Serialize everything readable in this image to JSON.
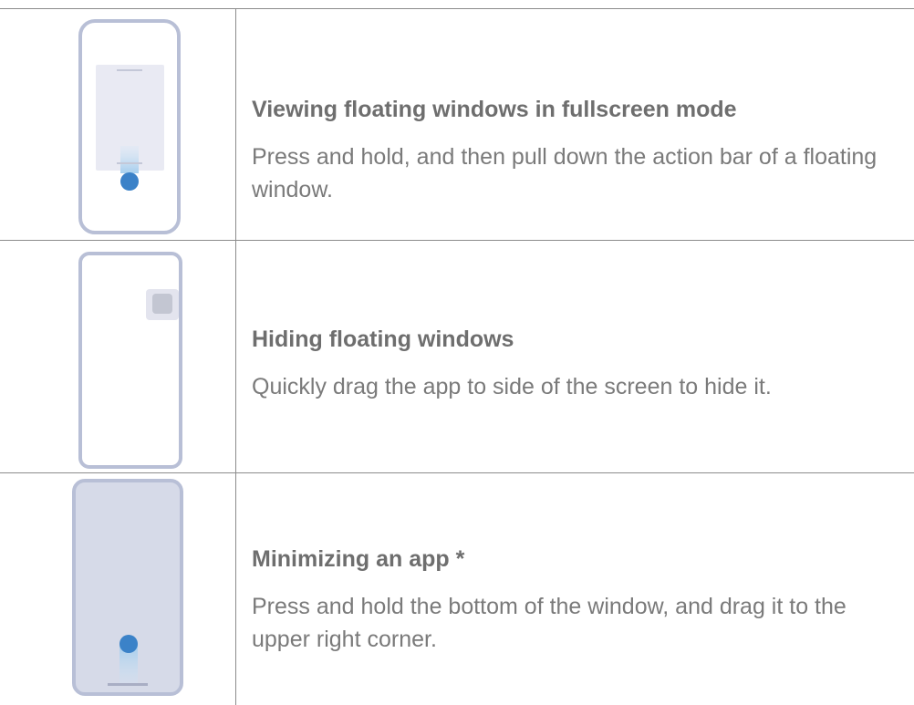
{
  "rows": [
    {
      "title": "Viewing floating windows in fullscreen mode",
      "description": "Press and hold, and then pull down the action bar of a floating  window.",
      "icon": "phone-fullscreen-gesture-icon"
    },
    {
      "title": "Hiding floating windows",
      "description": "Quickly drag the app to side of the screen to hide it.",
      "icon": "phone-hide-window-icon"
    },
    {
      "title": "Minimizing an app *",
      "description": "Press and hold the bottom of the window, and drag it to the upper right corner.",
      "icon": "phone-minimize-gesture-icon"
    }
  ],
  "colors": {
    "phone_outline": "#b8bfd6",
    "phone_fill_light": "#e9eaf3",
    "phone_fill_full": "#d6dae8",
    "touch_dot": "#3b82c8",
    "text_title": "#6e6e6e",
    "text_body": "#7a7a7a",
    "rule": "#8c8c8c"
  }
}
